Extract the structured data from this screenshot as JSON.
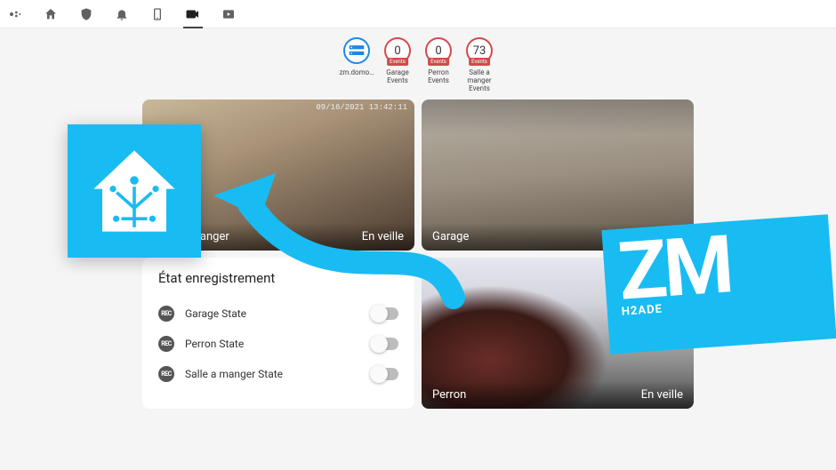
{
  "topbar": {
    "tabs": [
      "assistant",
      "home",
      "shield",
      "bell",
      "tablet",
      "camera",
      "play"
    ]
  },
  "chips": [
    {
      "id": "host",
      "value": "",
      "label": "zm.domo…",
      "blue": true
    },
    {
      "id": "garage",
      "value": "0",
      "label": "Garage Events",
      "badge": "Events"
    },
    {
      "id": "perron",
      "value": "0",
      "label": "Perron Events",
      "badge": "Events"
    },
    {
      "id": "salle",
      "value": "73",
      "label": "Salle a manger Events",
      "badge": "Events"
    }
  ],
  "cams": {
    "kitchen": {
      "name": "Salle à manger",
      "status": "En veille",
      "ts": "09/16/2021 13:42:11"
    },
    "garage": {
      "name": "Garage",
      "status": ""
    },
    "perron": {
      "name": "Perron",
      "status": "En veille"
    }
  },
  "panel": {
    "title": "État enregistrement",
    "rows": [
      {
        "label": "Garage State"
      },
      {
        "label": "Perron State"
      },
      {
        "label": "Salle a manger State"
      }
    ]
  },
  "overlays": {
    "zm_big": "ZM",
    "zm_small": "H2ADE"
  }
}
